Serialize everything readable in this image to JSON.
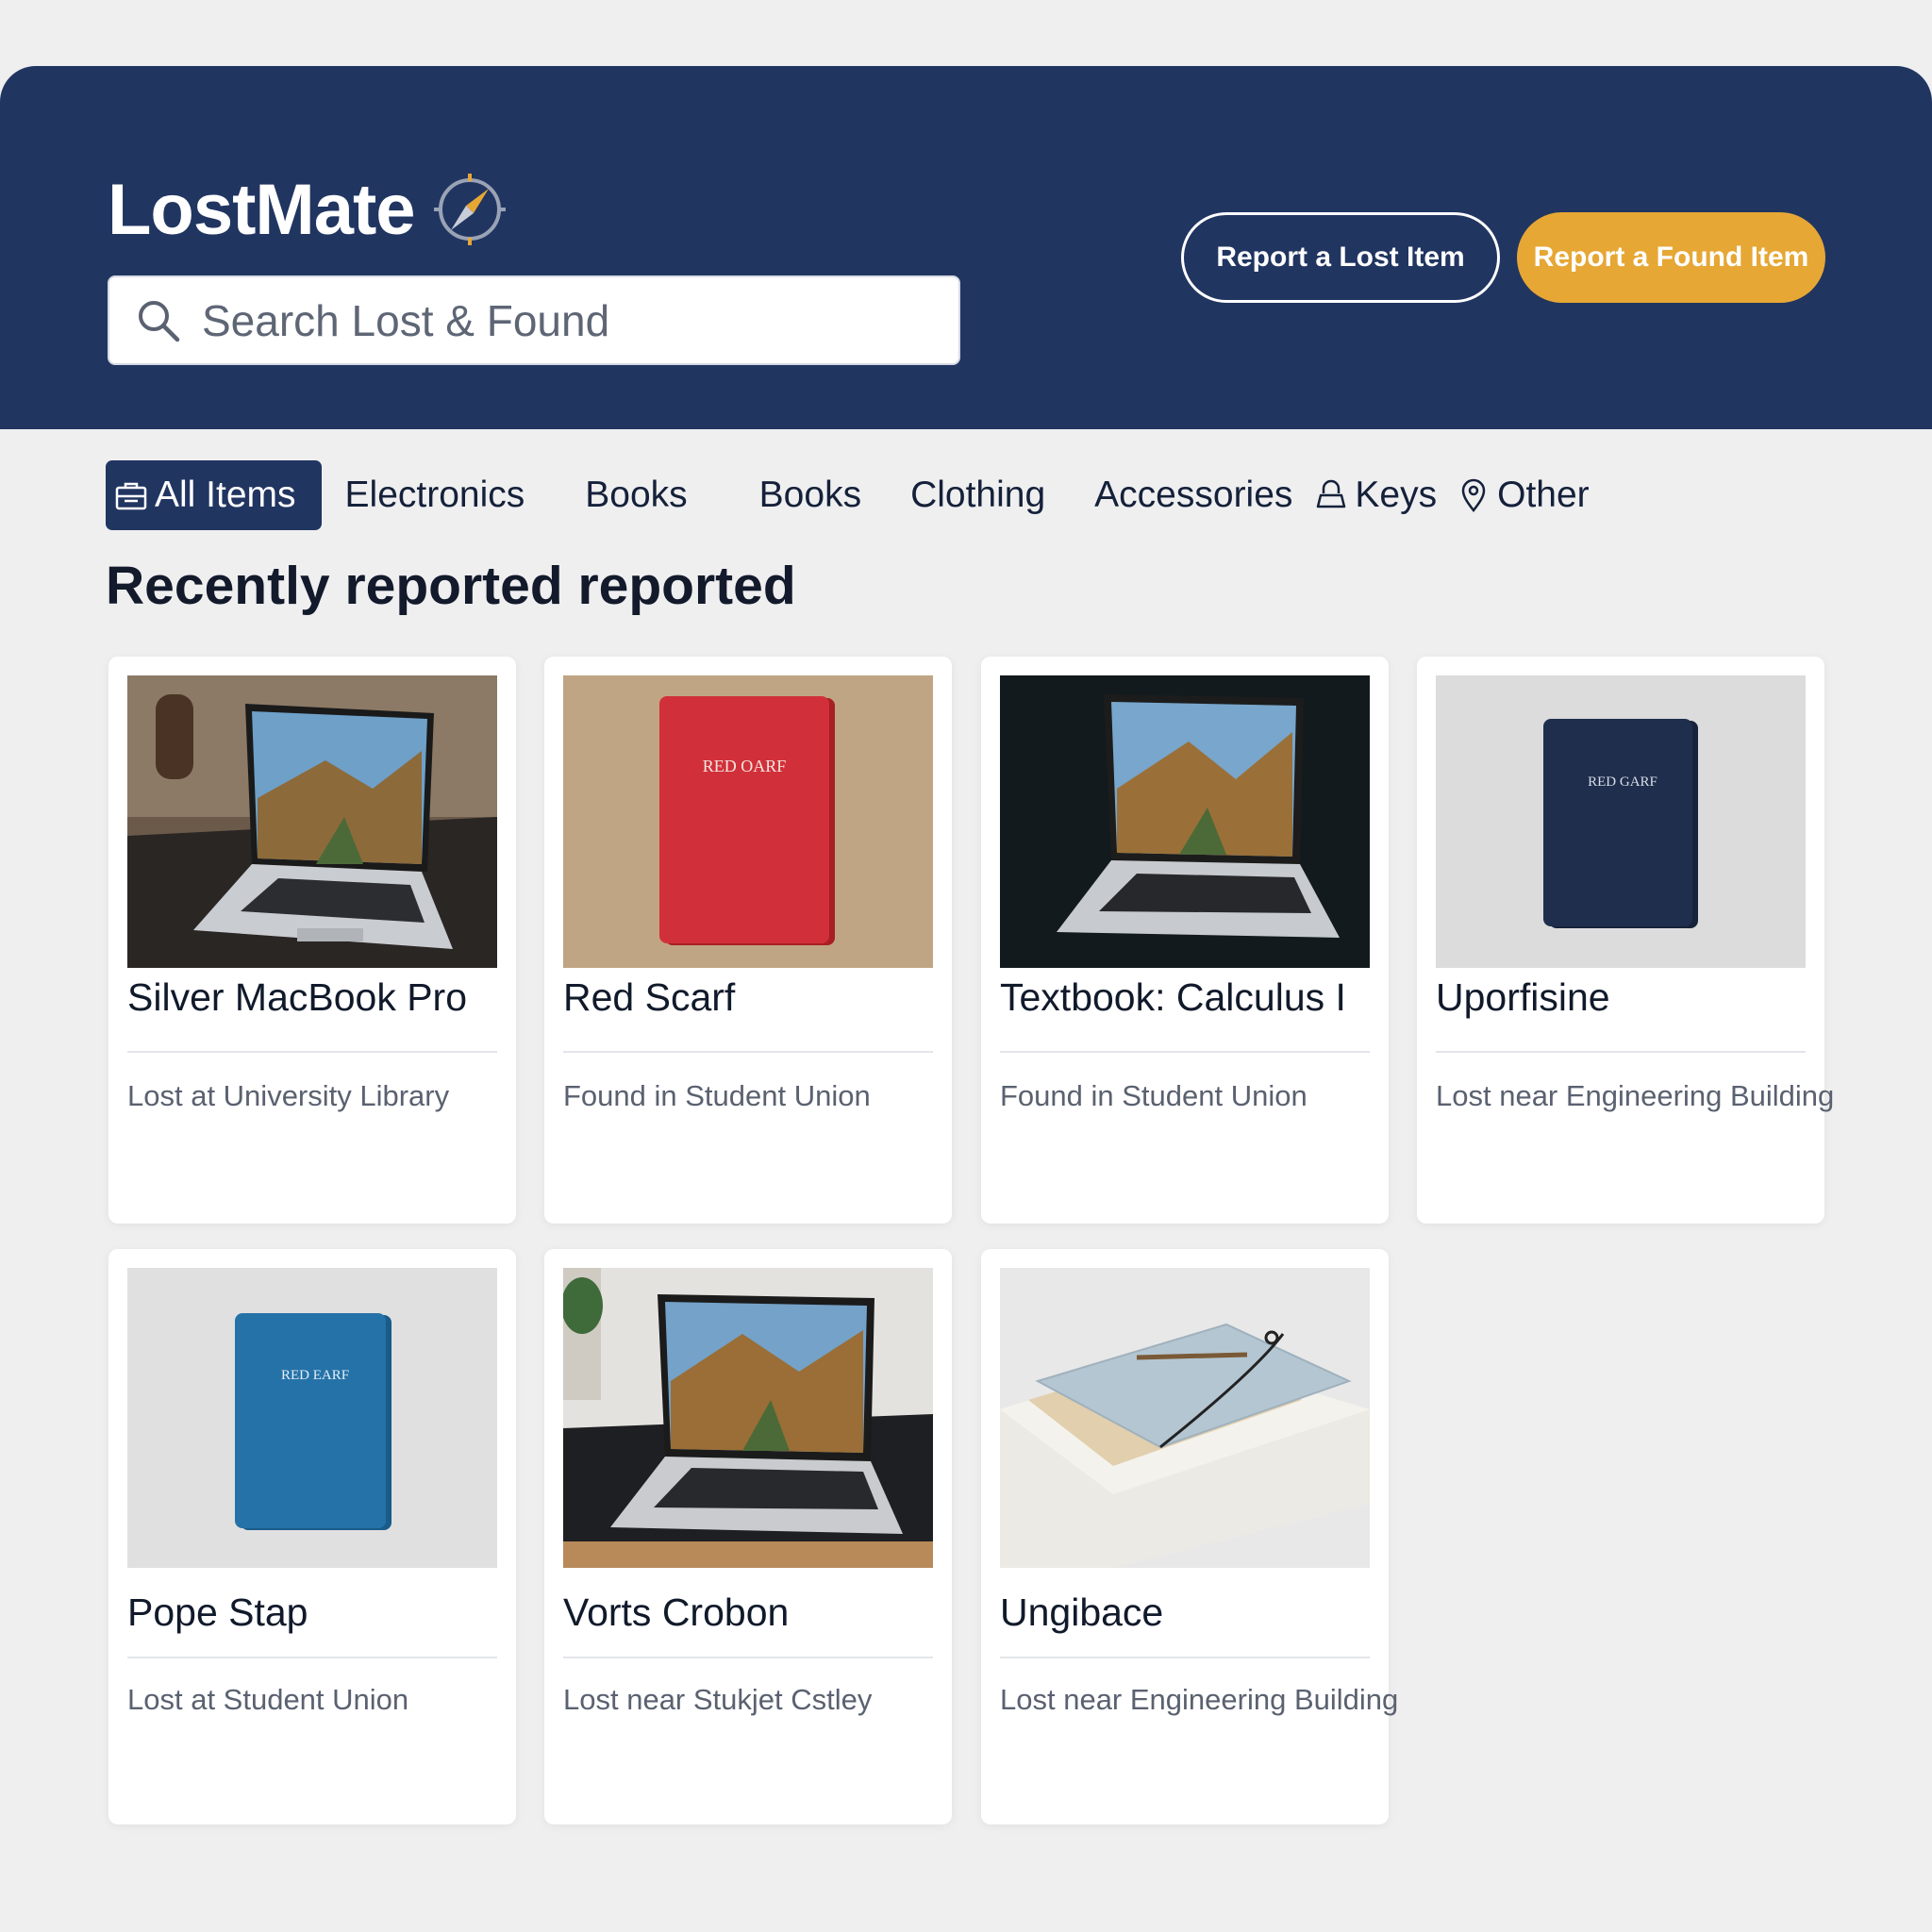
{
  "app": {
    "name": "LostMate"
  },
  "search": {
    "placeholder": "Search Lost & Found"
  },
  "actions": {
    "report_lost": "Report a Lost Item",
    "report_found": "Report a Found Item"
  },
  "categories": [
    {
      "label": "All Items",
      "icon": "briefcase-icon",
      "active": true
    },
    {
      "label": "Electronics"
    },
    {
      "label": "Books"
    },
    {
      "label": "Books"
    },
    {
      "label": "Clothing"
    },
    {
      "label": "Accessories"
    },
    {
      "label": "Keys",
      "icon": "lock-icon"
    },
    {
      "label": "Other",
      "icon": "map-pin-icon"
    }
  ],
  "section": {
    "title": "Recently reported reported"
  },
  "items": [
    {
      "title": "Silver MacBook Pro",
      "location": "Lost at University Library",
      "image": "laptop"
    },
    {
      "title": "Red Scarf",
      "location": "Found in Student Union",
      "image": "red-book",
      "cover_text": "RED OARF"
    },
    {
      "title": "Textbook: Calculus I",
      "location": "Found in Student Union",
      "image": "laptop-dark"
    },
    {
      "title": "Uporfisine",
      "location": "Lost near Engineering Building",
      "image": "navy-book",
      "cover_text": "RED GARF"
    },
    {
      "title": "Pope Stap",
      "location": "Lost at Student Union",
      "image": "blue-book",
      "cover_text": "RED EARF"
    },
    {
      "title": "Vorts Crobon",
      "location": "Lost near Stukjet Cstley",
      "image": "laptop-desk"
    },
    {
      "title": "Ungibace",
      "location": "Lost near Engineering Building",
      "image": "notebooks"
    }
  ],
  "colors": {
    "header": "#213561",
    "accent": "#e6a734",
    "background": "#efeff0"
  }
}
